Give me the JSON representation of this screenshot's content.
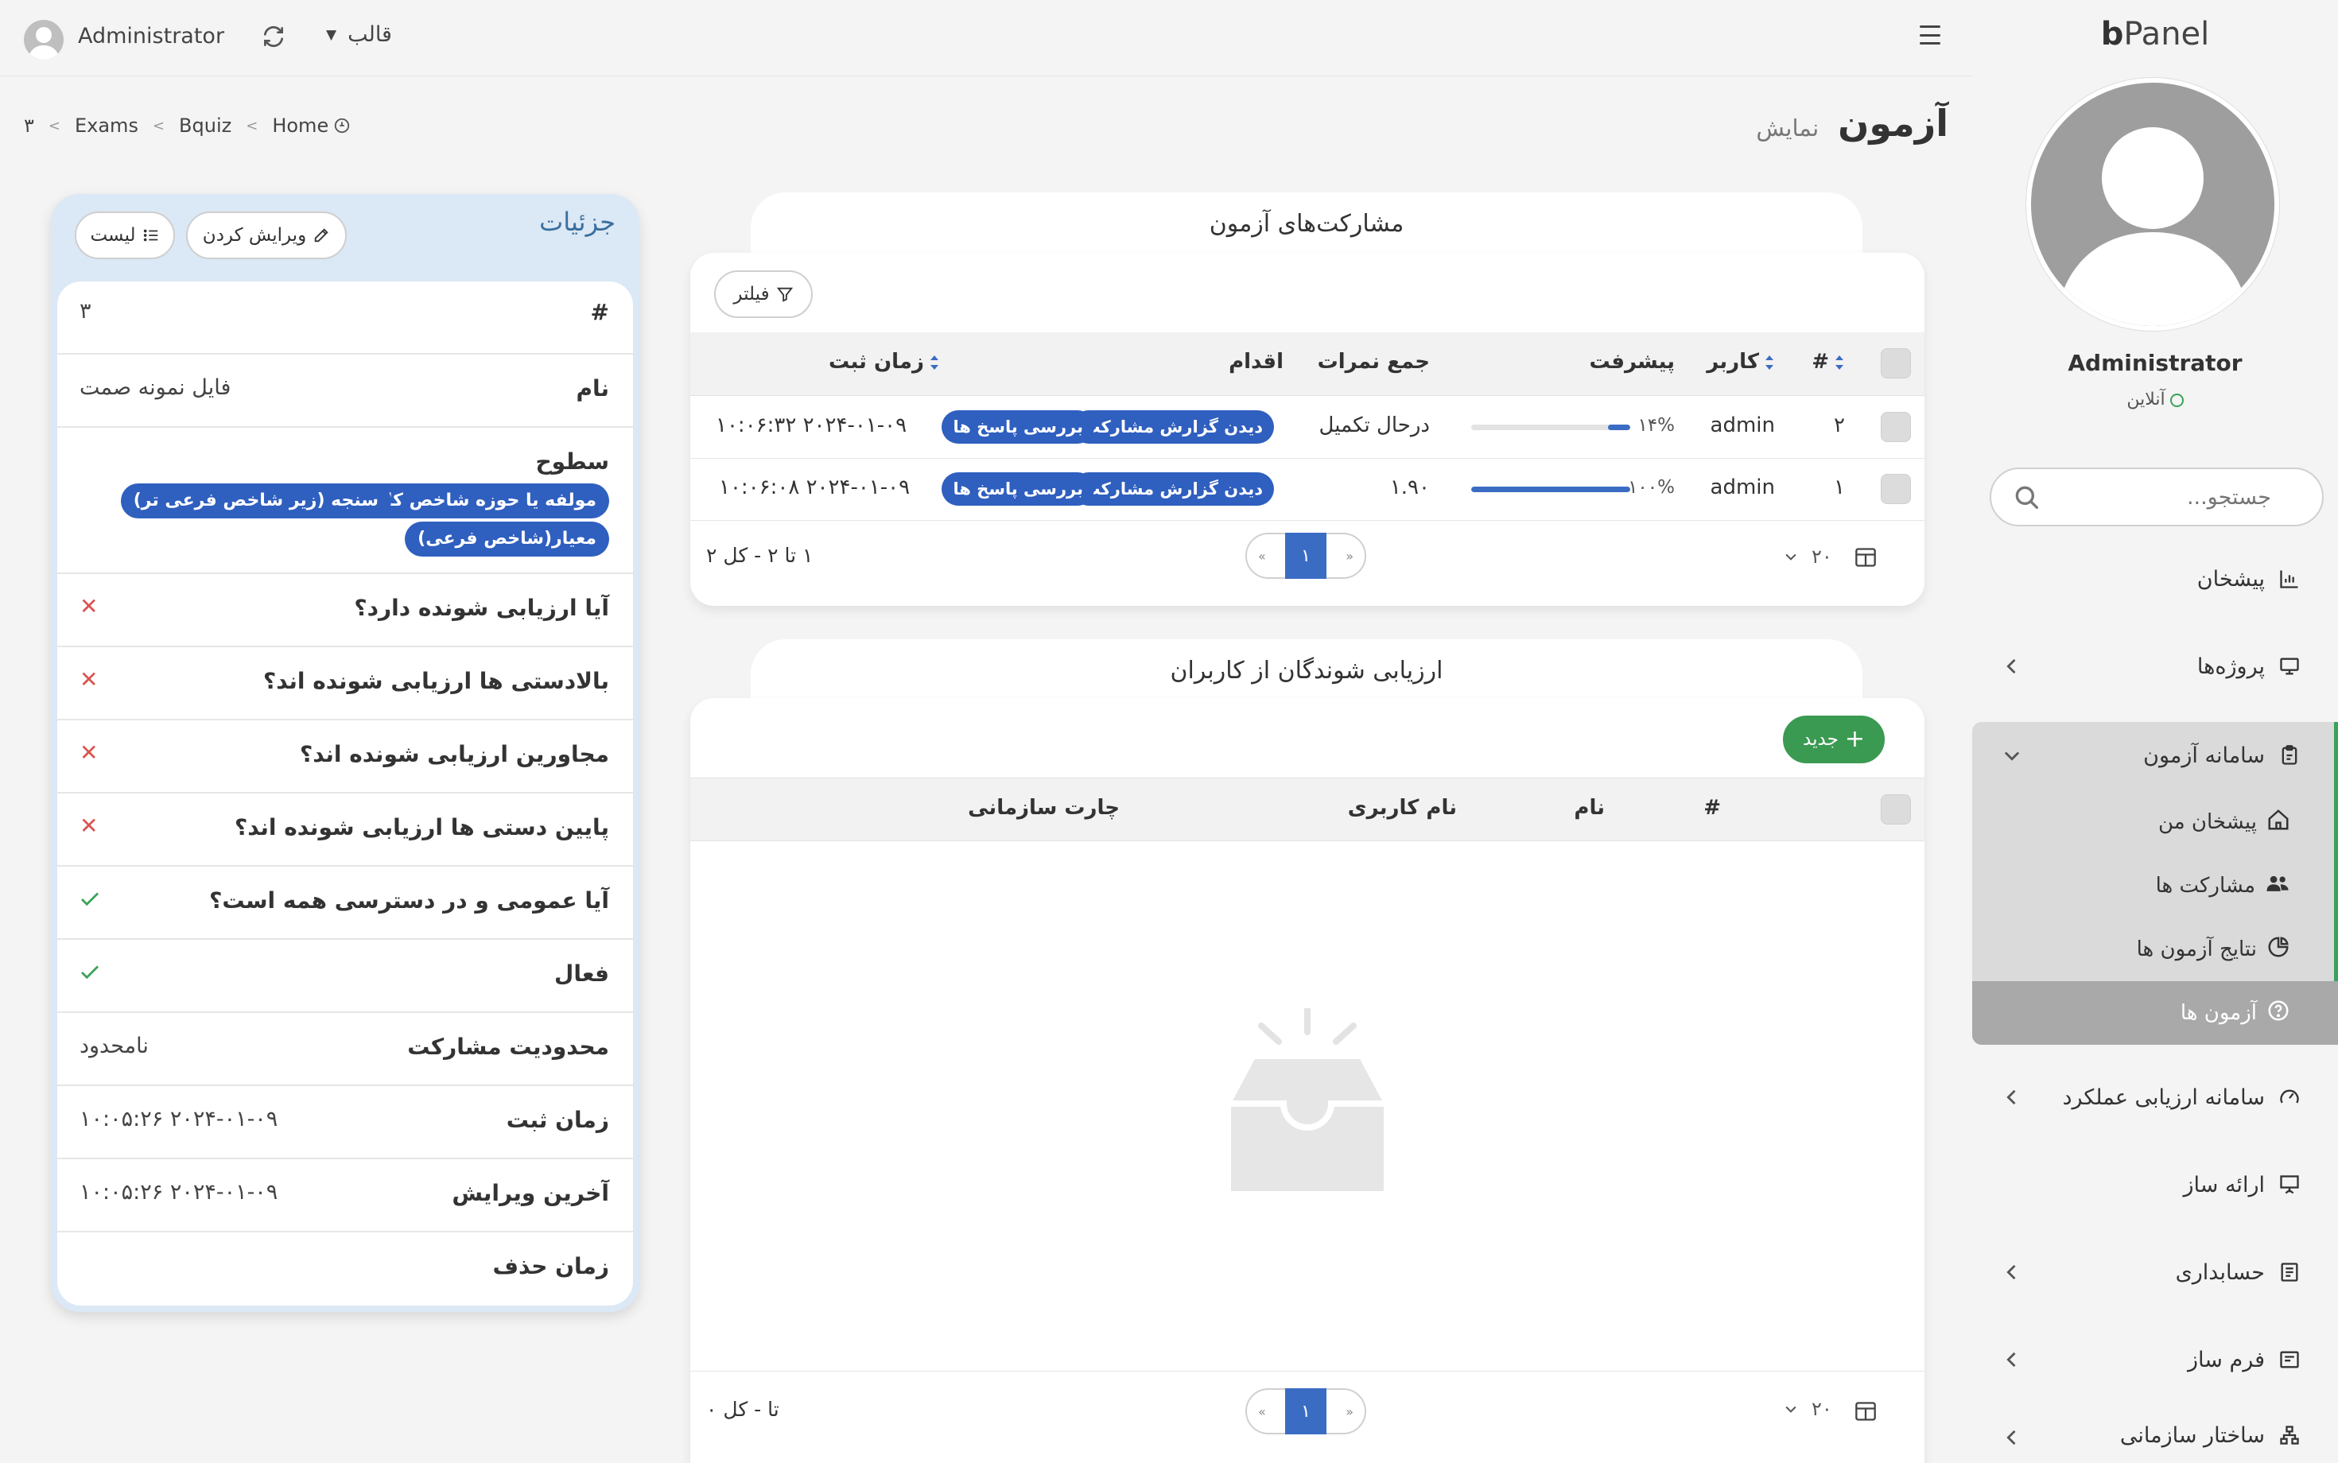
{
  "topbar": {
    "user_name": "Administrator",
    "theme_label": "قالب"
  },
  "sidebar": {
    "brand_bold": "b",
    "brand_rest": "Panel",
    "user_name": "Administrator",
    "status": "آنلاین",
    "search_placeholder": "جستجو...",
    "items": [
      {
        "label": "پیشخان"
      },
      {
        "label": "پروژه‌ها"
      },
      {
        "label": "سامانه آزمون"
      },
      {
        "label": "سامانه ارزیابی عملکرد"
      },
      {
        "label": "ارائه ساز"
      },
      {
        "label": "حسابداری"
      },
      {
        "label": "فرم ساز"
      },
      {
        "label": "ساختار سازمانی"
      }
    ],
    "sub_items": [
      {
        "label": "پیشخان من"
      },
      {
        "label": "مشارکت ها"
      },
      {
        "label": "نتایج آزمون ها"
      },
      {
        "label": "آزمون ها"
      }
    ]
  },
  "page": {
    "title": "آزمون",
    "subtitle": "نمایش"
  },
  "breadcrumb": [
    "Home",
    "Bquiz",
    "Exams",
    "۳"
  ],
  "participations": {
    "title": "مشارکت‌های آزمون",
    "filter_label": "فیلتر",
    "columns": [
      "#",
      "کاربر",
      "پیشرفت",
      "جمع نمرات",
      "اقدام",
      "زمان ثبت"
    ],
    "rows": [
      {
        "id": "۲",
        "user": "admin",
        "progress": 14,
        "progress_label": "۱۴%",
        "score": "درحال تکمیل",
        "action1": "دیدن گزارش مشارکت",
        "action2": "بررسی پاسخ ها",
        "time": "۲۰۲۴-۰۱-۰۹ ۱۰:۰۶:۳۲"
      },
      {
        "id": "۱",
        "user": "admin",
        "progress": 100,
        "progress_label": "۱۰۰%",
        "score": "۱.۹۰",
        "action1": "دیدن گزارش مشارکت",
        "action2": "بررسی پاسخ ها",
        "time": "۲۰۲۴-۰۱-۰۹ ۱۰:۰۶:۰۸"
      }
    ],
    "page_size": "۲۰",
    "current_page": "۱",
    "summary": "۱ تا ۲ - کل ۲"
  },
  "evaluatees": {
    "title": "ارزیابی شوندگان از کاربران",
    "new_label": "جدید",
    "columns": [
      "#",
      "نام",
      "نام کاربری",
      "چارت سازمانی"
    ],
    "page_size": "۲۰",
    "current_page": "۱",
    "summary": "تا - کل ۰"
  },
  "details": {
    "title": "جزئیات",
    "edit_label": "ویرایش کردن",
    "list_label": "لیست",
    "rows": [
      {
        "key": "#",
        "value": "۳"
      },
      {
        "key": "نام",
        "value": "فایل نمونه صمت"
      },
      {
        "key": "سطوح",
        "tags": [
          "مولفه یا حوزه شاخص کلان",
          "سنجه (زیر شاخص فرعی تر)",
          "معیار(شاخص فرعی)"
        ]
      },
      {
        "key": "آیا ارزیابی شونده دارد؟",
        "bool": false
      },
      {
        "key": "بالادستی ها ارزیابی شونده اند؟",
        "bool": false
      },
      {
        "key": "مجاورین ارزیابی شونده اند؟",
        "bool": false
      },
      {
        "key": "پایین دستی ها ارزیابی شونده اند؟",
        "bool": false
      },
      {
        "key": "آیا عمومی و در دسترسی همه است؟",
        "bool": true
      },
      {
        "key": "فعال",
        "bool": true
      },
      {
        "key": "محدودیت مشارکت",
        "value": "نامحدود"
      },
      {
        "key": "زمان ثبت",
        "value": "۲۰۲۴-۰۱-۰۹ ۱۰:۰۵:۲۶"
      },
      {
        "key": "آخرین ویرایش",
        "value": "۲۰۲۴-۰۱-۰۹ ۱۰:۰۵:۲۶"
      },
      {
        "key": "زمان حذف",
        "value": ""
      }
    ]
  },
  "colors": {
    "accent": "#3b6cc4",
    "success": "#3aa25a",
    "danger": "#d9534f",
    "tag": "#2f5fbf"
  }
}
